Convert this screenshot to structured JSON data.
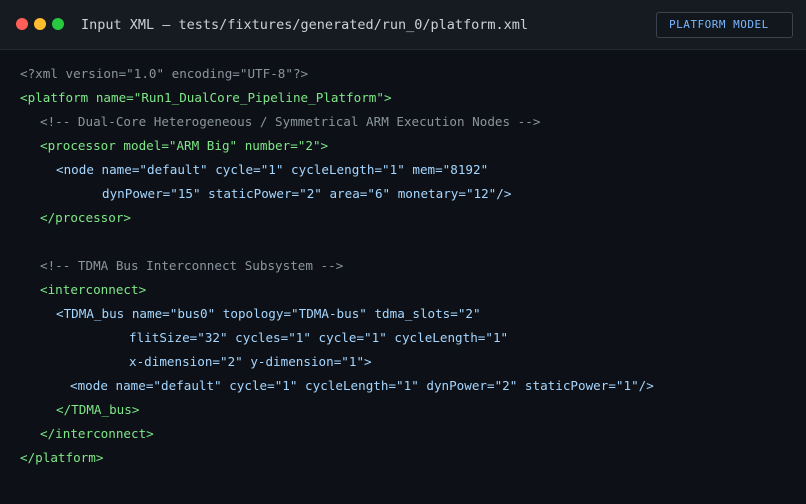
{
  "window": {
    "title": "Input XML — tests/fixtures/generated/run_0/platform.xml",
    "badge": "PLATFORM MODEL"
  },
  "code_lines": [
    "<?xml version=\"1.0\" encoding=\"UTF-8\"?>",
    "<platform name=\"Run1_DualCore_Pipeline_Platform\">",
    "<!-- Dual-Core Heterogeneous / Symmetrical ARM Execution Nodes -->",
    "<processor model=\"ARM Big\" number=\"2\">",
    "<node name=\"default\" cycle=\"1\" cycleLength=\"1\" mem=\"8192\"",
    "dynPower=\"15\" staticPower=\"2\" area=\"6\" monetary=\"12\"/>",
    "</processor>",
    "",
    "<!-- TDMA Bus Interconnect Subsystem -->",
    "<interconnect>",
    "<TDMA_bus name=\"bus0\" topology=\"TDMA-bus\" tdma_slots=\"2\"",
    "flitSize=\"32\" cycles=\"1\" cycle=\"1\" cycleLength=\"1\"",
    "x-dimension=\"2\" y-dimension=\"1\">",
    "<mode name=\"default\" cycle=\"1\" cycleLength=\"1\" dynPower=\"2\" staticPower=\"1\"/>",
    "</TDMA_bus>",
    "</interconnect>",
    "</platform>"
  ],
  "colors": {
    "background": "#0d1117",
    "titlebar": "#161b22",
    "green_tag": "#7ee787",
    "blue_tag": "#a5d6ff",
    "comment": "#8b949e",
    "badge_text": "#79b8ff"
  }
}
